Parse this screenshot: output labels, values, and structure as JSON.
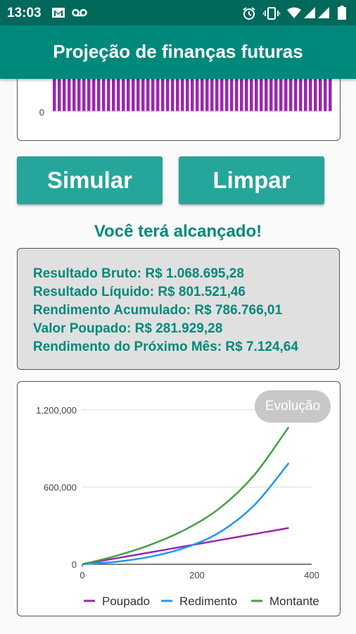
{
  "status_bar": {
    "time": "13:03",
    "left_icons": [
      "gmail-icon",
      "voicemail-icon"
    ],
    "right_icons": [
      "alarm-icon",
      "vibrate-icon",
      "wifi-icon",
      "signal-icon",
      "signal-icon",
      "battery-icon"
    ]
  },
  "app_bar": {
    "title": "Projeção de finanças futuras"
  },
  "top_chart": {
    "y_tick": "0",
    "bar_color": "#9c27b0"
  },
  "buttons": {
    "simulate": "Simular",
    "clear": "Limpar"
  },
  "result_title": "Você terá alcançado!",
  "results": [
    "Resultado Bruto: R$ 1.068.695,28",
    "Resultado Líquido: R$ 801.521,46",
    "Rendimento Acumulado: R$ 786.766,01",
    "Valor Poupado: R$ 281.929,28",
    "Rendimento do Próximo Mês: R$ 7.124,64"
  ],
  "evolution_button": "Evolução",
  "chart_data": {
    "type": "line",
    "x_ticks": [
      "0",
      "200",
      "400"
    ],
    "y_ticks": [
      "0",
      "600,000",
      "1,200,000"
    ],
    "xlim": [
      0,
      400
    ],
    "ylim": [
      0,
      1200000
    ],
    "grid": true,
    "legend_position": "bottom",
    "series": [
      {
        "name": "Poupado",
        "color": "#9c27b0",
        "x": [
          0,
          60,
          120,
          180,
          240,
          300,
          360
        ],
        "y": [
          0,
          47000,
          94000,
          141000,
          188000,
          235000,
          282000
        ]
      },
      {
        "name": "Redimento",
        "color": "#2196f3",
        "x": [
          0,
          60,
          120,
          180,
          240,
          300,
          360
        ],
        "y": [
          0,
          20000,
          60000,
          130000,
          250000,
          460000,
          787000
        ]
      },
      {
        "name": "Montante",
        "color": "#43a047",
        "x": [
          0,
          60,
          120,
          180,
          240,
          300,
          360
        ],
        "y": [
          0,
          67000,
          154000,
          271000,
          438000,
          695000,
          1068000
        ]
      }
    ]
  }
}
